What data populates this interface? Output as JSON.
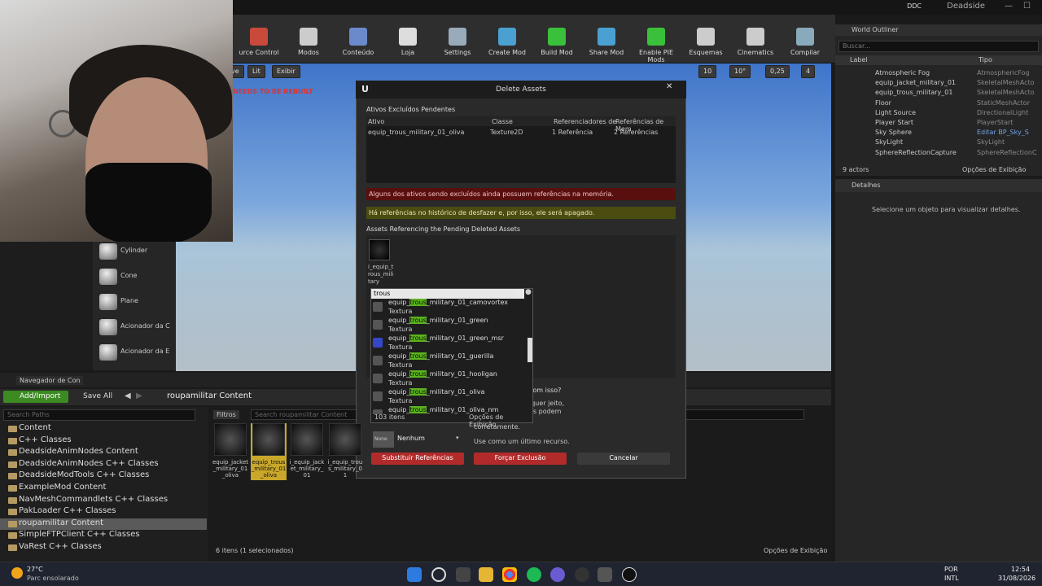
{
  "titlebar": {
    "ddc": "DDC",
    "project": "Deadside",
    "min": "—",
    "max": "☐"
  },
  "toolbar": [
    {
      "label": "urce Control",
      "color": "#c94a3a"
    },
    {
      "label": "Modos",
      "color": "#ccc"
    },
    {
      "label": "Conteúdo",
      "color": "#6a8acb"
    },
    {
      "label": "Loja",
      "color": "#ddd"
    },
    {
      "label": "Settings",
      "color": "#9ab"
    },
    {
      "label": "Create Mod",
      "color": "#4aa0d0"
    },
    {
      "label": "Build Mod",
      "color": "#3ac03a"
    },
    {
      "label": "Share Mod",
      "color": "#4aa0d0"
    },
    {
      "label": "Enable PIE Mods",
      "color": "#3ac03a"
    },
    {
      "label": "Esquemas",
      "color": "#ccc"
    },
    {
      "label": "Cinematics",
      "color": "#ccc"
    },
    {
      "label": "Compilar",
      "color": "#8ab"
    }
  ],
  "viewport": {
    "view_mode": "ve",
    "lit": "Lit",
    "show": "Exibir",
    "rebuild": "NEEDS TO BE REBUILT",
    "grid": "10",
    "angle": "10°",
    "scale": "0,25",
    "cams": "4"
  },
  "placer": [
    "Cylinder",
    "Cone",
    "Plane",
    "Acionador da C",
    "Acionador da E"
  ],
  "outliner": {
    "title": "World Outliner",
    "search": "Buscar...",
    "col_label": "Label",
    "col_type": "Tipo",
    "rows": [
      {
        "label": "Atmospheric Fog",
        "type": "AtmosphericFog"
      },
      {
        "label": "equip_jacket_military_01",
        "type": "SkeletalMeshActo"
      },
      {
        "label": "equip_trous_military_01",
        "type": "SkeletalMeshActo"
      },
      {
        "label": "Floor",
        "type": "StaticMeshActor"
      },
      {
        "label": "Light Source",
        "type": "DirectionalLight"
      },
      {
        "label": "Player Start",
        "type": "PlayerStart"
      },
      {
        "label": "Sky Sphere",
        "type": "Editar BP_Sky_S"
      },
      {
        "label": "SkyLight",
        "type": "SkyLight"
      },
      {
        "label": "SphereReflectionCapture",
        "type": "SphereReflectionC"
      }
    ],
    "count": "9 actors",
    "view_options": "Opções de Exibição"
  },
  "details": {
    "title": "Detalhes",
    "empty": "Selecione um objeto para visualizar detalhes."
  },
  "content_browser": {
    "tab": "Navegador de Con",
    "add_import": "Add/Import",
    "save_all": "Save All",
    "path": "roupamilitar Content",
    "search_paths": "Search Paths",
    "filters": "Filtros",
    "search_assets": "Search roupamilitar Content",
    "status": "6 itens (1 selecionados)",
    "view_options": "Opções de Exibição"
  },
  "paths": [
    "Content",
    "C++ Classes",
    "DeadsideAnimNodes Content",
    "DeadsideAnimNodes C++ Classes",
    "DeadsideModTools C++ Classes",
    "ExampleMod Content",
    "NavMeshCommandlets C++ Classes",
    "PakLoader C++ Classes",
    "roupamilitar Content",
    "SimpleFTPClient C++ Classes",
    "VaRest C++ Classes"
  ],
  "assets": [
    "equip_jacket_military_01_oliva",
    "equip_trous_military_01_oliva",
    "i_equip_jacket_military_01",
    "i_equip_trous_military_01"
  ],
  "dialog": {
    "title": "Delete Assets",
    "pending_title": "Ativos Excluídos Pendentes",
    "cols": [
      "Ativo",
      "Classe",
      "Referenciadores de",
      "Referências de Mem"
    ],
    "row": [
      "equip_trous_military_01_oliva",
      "Texture2D",
      "1 Referência",
      "2 Referências"
    ],
    "warn_red": "Alguns dos ativos sendo excluídos ainda possuem referências na memória.",
    "warn_yellow": "Há referências no histórico de desfazer e, por isso, ele será apagado.",
    "ref_title": "Assets Referencing the Pending Deleted Assets",
    "ref_asset": "i_equip_trous_military",
    "question": "com isso?",
    "hint1": "lquer jeito,",
    "hint2": "es podem",
    "hint3": "corretamente.",
    "last_resort": "Use como um último recurso.",
    "none": "Nenhum",
    "replace": "Substituir Referências",
    "force": "Forçar Exclusão",
    "cancel": "Cancelar"
  },
  "picker": {
    "search": "trous",
    "items": [
      {
        "pre": "equip_",
        "hl": "trous",
        "post": "_military_01_camovortex",
        "kind": "Textura",
        "color": "#555"
      },
      {
        "pre": "equip_",
        "hl": "trous",
        "post": "_military_01_green",
        "kind": "Textura",
        "color": "#555"
      },
      {
        "pre": "equip_",
        "hl": "trous",
        "post": "_military_01_green_msr",
        "kind": "Textura",
        "color": "#3546c8"
      },
      {
        "pre": "equip_",
        "hl": "trous",
        "post": "_military_01_guerilla",
        "kind": "Textura",
        "color": "#555"
      },
      {
        "pre": "equip_",
        "hl": "trous",
        "post": "_military_01_hooligan",
        "kind": "Textura",
        "color": "#555"
      },
      {
        "pre": "equip_",
        "hl": "trous",
        "post": "_military_01_oliva",
        "kind": "Textura",
        "color": "#555"
      },
      {
        "pre": "equip_",
        "hl": "trous",
        "post": "_military_01_oliva_nm",
        "kind": "",
        "color": "#555"
      }
    ],
    "count": "103 itens",
    "view_options": "Opções de Exibição"
  },
  "taskbar": {
    "temp": "27°C",
    "weather": "Parc ensolarado",
    "lang1": "POR",
    "lang2": "INTL",
    "time": "12:54",
    "date": "31/08/2026"
  }
}
